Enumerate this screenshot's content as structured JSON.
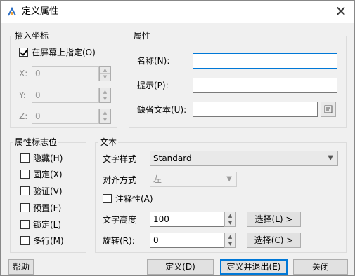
{
  "window": {
    "title": "定义属性",
    "close_glyph": "✕"
  },
  "insert_point": {
    "legend": "插入坐标",
    "specify_on_screen": {
      "label": "在屏幕上指定(O)",
      "checked": true
    },
    "x": {
      "label": "X:",
      "value": "0"
    },
    "y": {
      "label": "Y:",
      "value": "0"
    },
    "z": {
      "label": "Z:",
      "value": "0"
    }
  },
  "attribute": {
    "legend": "属性",
    "name": {
      "label": "名称(N):",
      "value": ""
    },
    "prompt": {
      "label": "提示(P):",
      "value": ""
    },
    "default": {
      "label": "缺省文本(U):",
      "value": ""
    }
  },
  "flags": {
    "legend": "属性标志位",
    "items": [
      {
        "label": "隐藏(H)",
        "checked": false
      },
      {
        "label": "固定(X)",
        "checked": false
      },
      {
        "label": "验证(V)",
        "checked": false
      },
      {
        "label": "预置(F)",
        "checked": false
      },
      {
        "label": "锁定(L)",
        "checked": false
      },
      {
        "label": "多行(M)",
        "checked": false
      }
    ]
  },
  "text": {
    "legend": "文本",
    "style": {
      "label": "文字样式",
      "value": "Standard"
    },
    "justify": {
      "label": "对齐方式",
      "value": "左"
    },
    "annotative": {
      "label": "注释性(A)",
      "checked": false
    },
    "height": {
      "label": "文字高度",
      "value": "100",
      "pick_label": "选择(L) >"
    },
    "rotation": {
      "label": "旋转(R):",
      "value": "0",
      "pick_label": "选择(C) >"
    }
  },
  "buttons": {
    "help": "帮助",
    "define": "定义(D)",
    "define_exit": "定义并退出(E)",
    "close": "关闭"
  },
  "icons": {
    "app": "app-logo-icon",
    "close": "close-icon",
    "field": "insert-field-icon",
    "spin": "spin-arrows-icon",
    "dropdown": "chevron-down-icon"
  },
  "colors": {
    "accent": "#0078d7",
    "background": "#f0f0f0"
  }
}
